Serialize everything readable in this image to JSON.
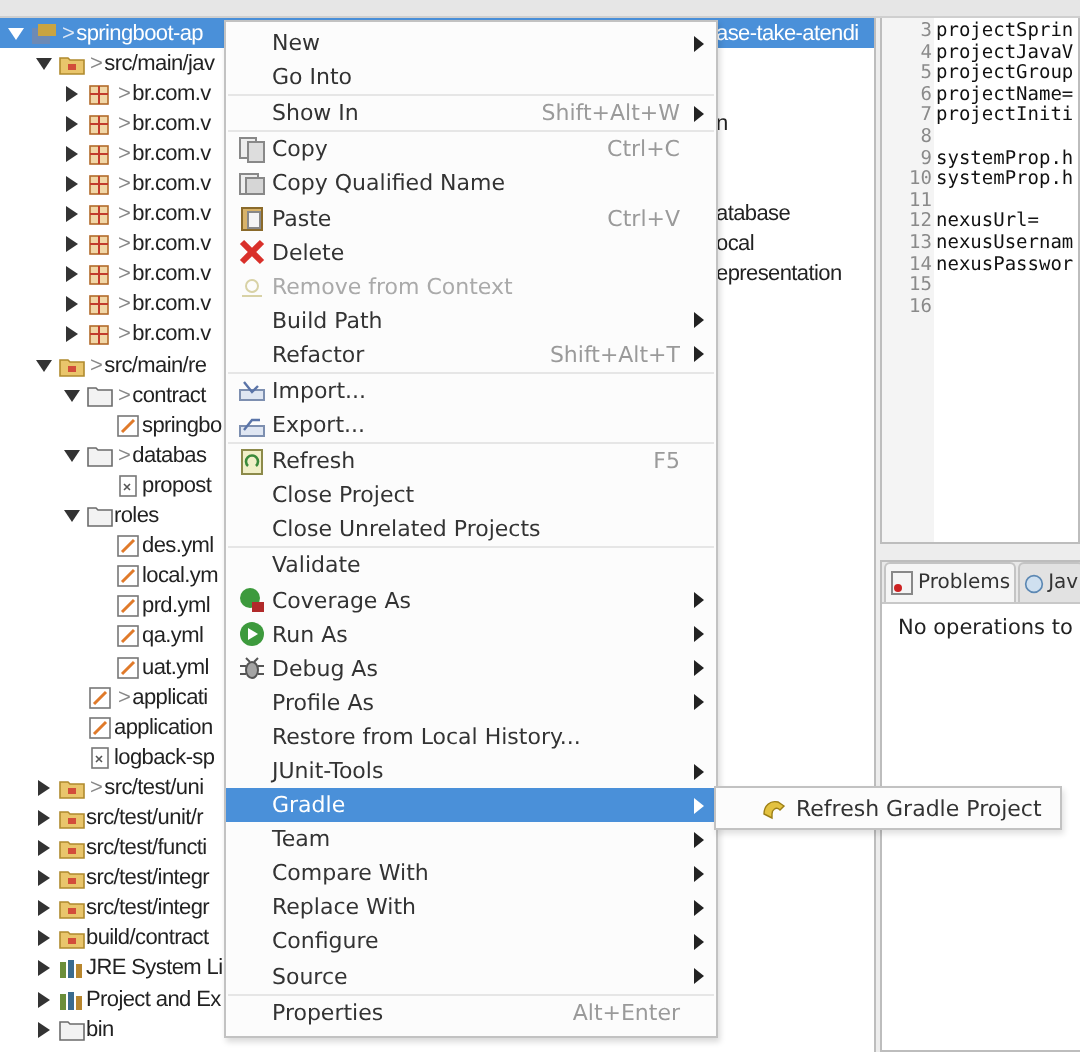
{
  "tree": {
    "items": [
      {
        "kind": "project",
        "label": "springboot-ap",
        "tail": "ase-take-atendi",
        "decoration": ">",
        "expanded": true,
        "selected": true,
        "children": [
          {
            "kind": "source-folder",
            "label": "src/main/jav",
            "decoration": ">",
            "expanded": true,
            "selected": false,
            "children": [
              {
                "kind": "package",
                "label": "br.com.v",
                "decoration": ">",
                "expanded": false,
                "selected": false
              },
              {
                "kind": "package",
                "label": "br.com.v",
                "tail": "n",
                "decoration": ">",
                "expanded": false,
                "selected": false
              },
              {
                "kind": "package",
                "label": "br.com.v",
                "decoration": ">",
                "expanded": false,
                "selected": false
              },
              {
                "kind": "package",
                "label": "br.com.v",
                "decoration": ">",
                "expanded": false,
                "selected": false
              },
              {
                "kind": "package",
                "label": "br.com.v",
                "tail": "atabase",
                "decoration": ">",
                "expanded": false,
                "selected": false
              },
              {
                "kind": "package",
                "label": "br.com.v",
                "tail": "ocal",
                "decoration": ">",
                "expanded": false,
                "selected": false
              },
              {
                "kind": "package",
                "label": "br.com.v",
                "tail": "epresentation",
                "decoration": ">",
                "expanded": false,
                "selected": false
              },
              {
                "kind": "package",
                "label": "br.com.v",
                "decoration": ">",
                "expanded": false,
                "selected": false
              },
              {
                "kind": "package",
                "label": "br.com.v",
                "decoration": ">",
                "expanded": false,
                "selected": false
              }
            ]
          },
          {
            "kind": "source-folder",
            "label": "src/main/re",
            "decoration": ">",
            "expanded": true,
            "selected": false,
            "children": [
              {
                "kind": "folder",
                "label": "contract",
                "decoration": ">",
                "expanded": true,
                "selected": false,
                "children": [
                  {
                    "kind": "yaml",
                    "label": "springbo",
                    "selected": false
                  }
                ]
              },
              {
                "kind": "folder",
                "label": "databas",
                "decoration": ">",
                "expanded": true,
                "selected": false,
                "children": [
                  {
                    "kind": "xml",
                    "label": "propost",
                    "selected": false
                  }
                ]
              },
              {
                "kind": "folder",
                "label": "roles",
                "expanded": true,
                "selected": false,
                "children": [
                  {
                    "kind": "yaml",
                    "label": "des.yml",
                    "selected": false
                  },
                  {
                    "kind": "yaml",
                    "label": "local.ym",
                    "selected": false
                  },
                  {
                    "kind": "yaml",
                    "label": "prd.yml",
                    "selected": false
                  },
                  {
                    "kind": "yaml",
                    "label": "qa.yml",
                    "selected": false
                  },
                  {
                    "kind": "yaml",
                    "label": "uat.yml",
                    "selected": false
                  }
                ]
              },
              {
                "kind": "yaml",
                "label": "applicati",
                "decoration": ">",
                "selected": false
              },
              {
                "kind": "yaml",
                "label": "application",
                "selected": false
              },
              {
                "kind": "xml",
                "label": "logback-sp",
                "selected": false
              }
            ]
          },
          {
            "kind": "source-folder",
            "label": "src/test/uni",
            "decoration": ">",
            "expanded": false,
            "selected": false
          },
          {
            "kind": "source-folder",
            "label": "src/test/unit/r",
            "expanded": false,
            "selected": false
          },
          {
            "kind": "source-folder",
            "label": "src/test/functi",
            "expanded": false,
            "selected": false
          },
          {
            "kind": "source-folder",
            "label": "src/test/integr",
            "expanded": false,
            "selected": false
          },
          {
            "kind": "source-folder",
            "label": "src/test/integr",
            "expanded": false,
            "selected": false
          },
          {
            "kind": "source-folder",
            "label": "build/contract",
            "expanded": false,
            "selected": false
          },
          {
            "kind": "library",
            "label": "JRE System Li",
            "expanded": false,
            "selected": false
          },
          {
            "kind": "library",
            "label": "Project and Ex",
            "expanded": false,
            "selected": false
          },
          {
            "kind": "folder",
            "label": "bin",
            "expanded": false,
            "selected": false
          }
        ]
      }
    ]
  },
  "editor": {
    "lines": [
      {
        "number": "3",
        "text": "projectSprin"
      },
      {
        "number": "4",
        "text": "projectJavaV"
      },
      {
        "number": "5",
        "text": "projectGroup"
      },
      {
        "number": "6",
        "text": "projectName="
      },
      {
        "number": "7",
        "text": "projectIniti"
      },
      {
        "number": "8"
      },
      {
        "number": "9",
        "text": "systemProp.h"
      },
      {
        "number": "10",
        "text": "systemProp.h"
      },
      {
        "number": "11"
      },
      {
        "number": "12",
        "text": "nexusUrl="
      },
      {
        "number": "13",
        "text": "nexusUsernam"
      },
      {
        "number": "14",
        "text": "nexusPasswor"
      },
      {
        "number": "15"
      },
      {
        "number": "16"
      }
    ]
  },
  "bottom_panel": {
    "tabs": [
      {
        "label": "Problems",
        "kind": "problems",
        "selected": true
      },
      {
        "label": "Jav",
        "kind": "javadoc",
        "selected": false
      }
    ],
    "message": "No operations to"
  },
  "context_menu": {
    "groups": [
      [
        {
          "label": "New",
          "submenu": true,
          "disabled": false,
          "selected": false
        },
        {
          "label": "Go Into",
          "submenu": false,
          "disabled": false,
          "selected": false
        }
      ],
      [
        {
          "label": "Show In",
          "shortcut": "Shift+Alt+W",
          "submenu": true,
          "disabled": false,
          "selected": false
        }
      ],
      [
        {
          "label": "Copy",
          "kind": "copy",
          "shortcut": "Ctrl+C",
          "submenu": false,
          "disabled": false,
          "selected": false
        },
        {
          "label": "Copy Qualified Name",
          "kind": "copy-name",
          "submenu": false,
          "disabled": false,
          "selected": false
        },
        {
          "label": "Paste",
          "kind": "paste",
          "shortcut": "Ctrl+V",
          "submenu": false,
          "disabled": false,
          "selected": false
        },
        {
          "label": "Delete",
          "kind": "delete",
          "submenu": false,
          "disabled": false,
          "selected": false
        },
        {
          "label": "Remove from Context",
          "kind": "remove",
          "submenu": false,
          "disabled": true,
          "selected": false
        },
        {
          "label": "Build Path",
          "submenu": true,
          "disabled": false,
          "selected": false
        },
        {
          "label": "Refactor",
          "shortcut": "Shift+Alt+T",
          "submenu": true,
          "disabled": false,
          "selected": false
        }
      ],
      [
        {
          "label": "Import...",
          "kind": "import",
          "submenu": false,
          "disabled": false,
          "selected": false
        },
        {
          "label": "Export...",
          "kind": "export",
          "submenu": false,
          "disabled": false,
          "selected": false
        }
      ],
      [
        {
          "label": "Refresh",
          "kind": "refresh",
          "shortcut": "F5",
          "submenu": false,
          "disabled": false,
          "selected": false
        },
        {
          "label": "Close Project",
          "submenu": false,
          "disabled": false,
          "selected": false
        },
        {
          "label": "Close Unrelated Projects",
          "submenu": false,
          "disabled": false,
          "selected": false
        }
      ],
      [
        {
          "label": "Validate",
          "submenu": false,
          "disabled": false,
          "selected": false
        },
        {
          "label": "Coverage As",
          "kind": "coverage",
          "submenu": true,
          "disabled": false,
          "selected": false
        },
        {
          "label": "Run As",
          "kind": "run",
          "submenu": true,
          "disabled": false,
          "selected": false
        },
        {
          "label": "Debug As",
          "kind": "debug",
          "submenu": true,
          "disabled": false,
          "selected": false
        },
        {
          "label": "Profile As",
          "submenu": true,
          "disabled": false,
          "selected": false
        },
        {
          "label": "Restore from Local History...",
          "submenu": false,
          "disabled": false,
          "selected": false
        },
        {
          "label": "JUnit-Tools",
          "submenu": true,
          "disabled": false,
          "selected": false
        },
        {
          "label": "Gradle",
          "submenu": true,
          "disabled": false,
          "selected": true
        },
        {
          "label": "Team",
          "submenu": true,
          "disabled": false,
          "selected": false
        },
        {
          "label": "Compare With",
          "submenu": true,
          "disabled": false,
          "selected": false
        },
        {
          "label": "Replace With",
          "submenu": true,
          "disabled": false,
          "selected": false
        },
        {
          "label": "Configure",
          "submenu": true,
          "disabled": false,
          "selected": false
        },
        {
          "label": "Source",
          "submenu": true,
          "disabled": false,
          "selected": false
        }
      ],
      [
        {
          "label": "Properties",
          "shortcut": "Alt+Enter",
          "submenu": false,
          "disabled": false,
          "selected": false
        }
      ]
    ]
  },
  "submenu": {
    "items": [
      {
        "label": "Refresh Gradle Project",
        "kind": "gradle-refresh"
      }
    ]
  }
}
